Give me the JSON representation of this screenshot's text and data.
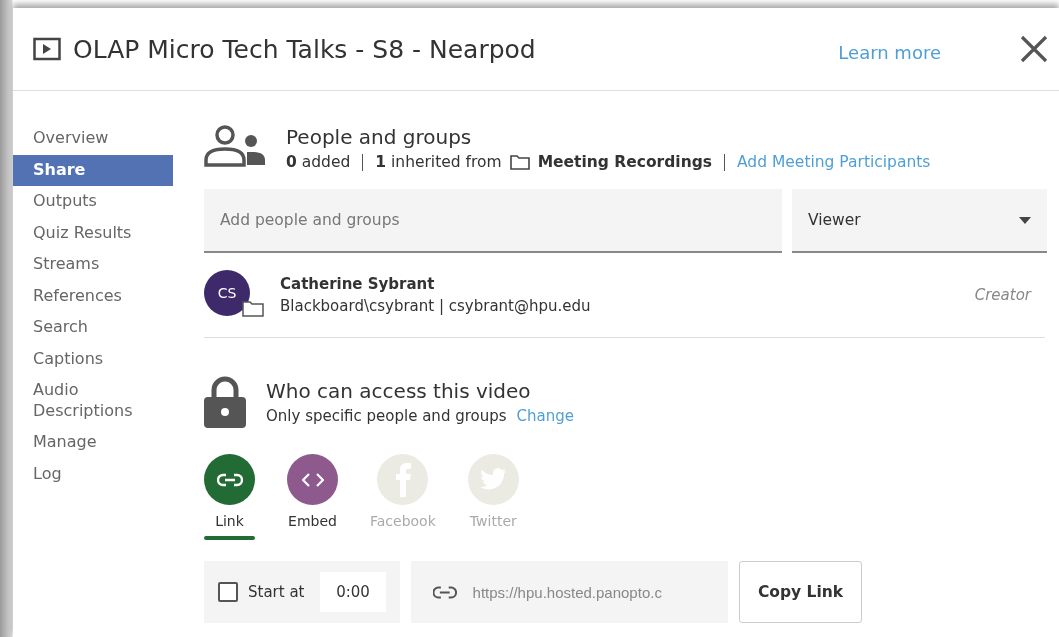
{
  "window": {
    "title": "OLAP Micro Tech Talks - S8 - Nearpod",
    "learn_more": "Learn more"
  },
  "sidebar": {
    "items": [
      {
        "label": "Overview",
        "selected": false
      },
      {
        "label": "Share",
        "selected": true
      },
      {
        "label": "Outputs",
        "selected": false
      },
      {
        "label": "Quiz Results",
        "selected": false
      },
      {
        "label": "Streams",
        "selected": false
      },
      {
        "label": "References",
        "selected": false
      },
      {
        "label": "Search",
        "selected": false
      },
      {
        "label": "Captions",
        "selected": false
      },
      {
        "label": "Audio Descriptions",
        "selected": false
      },
      {
        "label": "Manage",
        "selected": false
      },
      {
        "label": "Log",
        "selected": false
      }
    ]
  },
  "people": {
    "title": "People and groups",
    "added": "**0** added",
    "inherited": "**1** inherited from",
    "folder": "Meeting Recordings",
    "link": "Add Meeting Participants",
    "search": {
      "placeholder": "Add people and groups"
    },
    "role_dropdown": {
      "value": "Viewer"
    },
    "members": [
      {
        "initials": "CS",
        "name": "Catherine Sybrant",
        "detail": "Blackboard\\csybrant | csybrant@hpu.edu",
        "role": "Creator",
        "color": "#3e2a6b"
      }
    ]
  },
  "access": {
    "title": "Who can access this video",
    "description": "Only specific people and groups",
    "change": "Change"
  },
  "share_options": [
    {
      "kind": "link",
      "label": "Link",
      "selected": true,
      "disabled": false,
      "color": "#236b35"
    },
    {
      "kind": "embed",
      "label": "Embed",
      "selected": false,
      "disabled": false,
      "color": "#8e5a8e"
    },
    {
      "kind": "facebook",
      "label": "Facebook",
      "selected": false,
      "disabled": true,
      "color": "#ebebe4"
    },
    {
      "kind": "twitter",
      "label": "Twitter",
      "selected": false,
      "disabled": true,
      "color": "#ebebe4"
    }
  ],
  "link_row": {
    "start_at": {
      "label": "Start at",
      "checked": false,
      "value": "0:00"
    },
    "url": "https://hpu.hosted.panopto.c",
    "copy_button": "Copy Link"
  }
}
